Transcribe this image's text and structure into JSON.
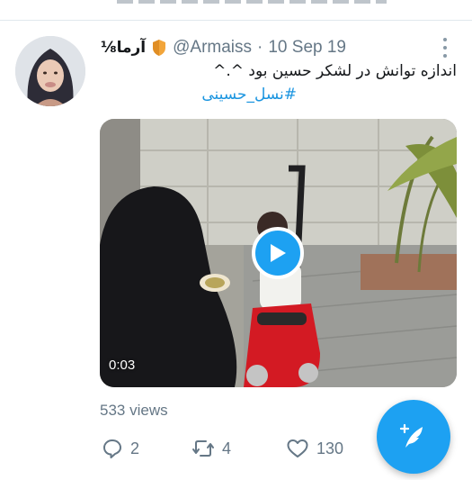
{
  "tweet": {
    "display_name": "آرما⅛",
    "handle": "@Armaiss",
    "separator": "·",
    "date": "10 Sep 19",
    "text": "اندازه توانش در لشکر حسین بود ^.^",
    "hashtag": "#نسل_حسینی",
    "video_duration": "0:03",
    "views": "533 views",
    "reply_count": "2",
    "retweet_count": "4",
    "like_count": "130"
  },
  "icons": {
    "badge": "shield-icon",
    "more": "more-vertical-icon",
    "play": "play-icon",
    "reply": "comment-icon",
    "retweet": "retweet-icon",
    "like": "heart-icon",
    "compose": "compose-tweet-icon"
  },
  "colors": {
    "accent": "#1da1f2",
    "hashtag": "#1b95e0",
    "secondary_text": "#657786",
    "badge": "#f2a53a"
  }
}
